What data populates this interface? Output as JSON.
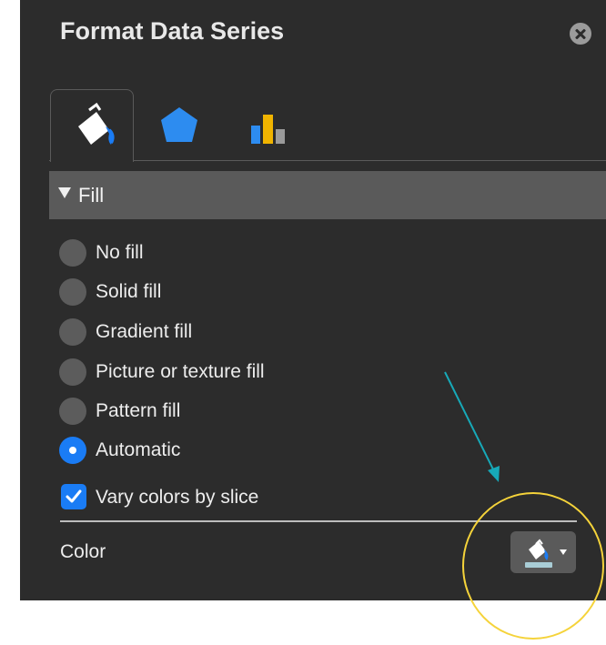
{
  "panel": {
    "title": "Format Data Series",
    "close_icon": "close-icon"
  },
  "tabs": [
    {
      "name": "fill-line",
      "icon": "paint-bucket-icon",
      "active": true
    },
    {
      "name": "effects",
      "icon": "pentagon-icon",
      "active": false
    },
    {
      "name": "series-options",
      "icon": "bar-chart-icon",
      "active": false
    }
  ],
  "fill": {
    "header": "Fill",
    "options": [
      {
        "label": "No fill",
        "checked": false
      },
      {
        "label": "Solid fill",
        "checked": false
      },
      {
        "label": "Gradient fill",
        "checked": false
      },
      {
        "label": "Picture or texture fill",
        "checked": false
      },
      {
        "label": "Pattern fill",
        "checked": false
      },
      {
        "label": "Automatic",
        "checked": true
      }
    ],
    "vary_colors": {
      "label": "Vary colors by slice",
      "checked": true
    },
    "color_label": "Color",
    "color_button_icon": "paint-bucket-icon"
  },
  "colors": {
    "panel_bg": "#2c2c2c",
    "header_bg": "#5a5a5a",
    "accent": "#1a7cf5",
    "annotation_arrow": "#17a9b8",
    "annotation_circle": "#f5d33a"
  }
}
